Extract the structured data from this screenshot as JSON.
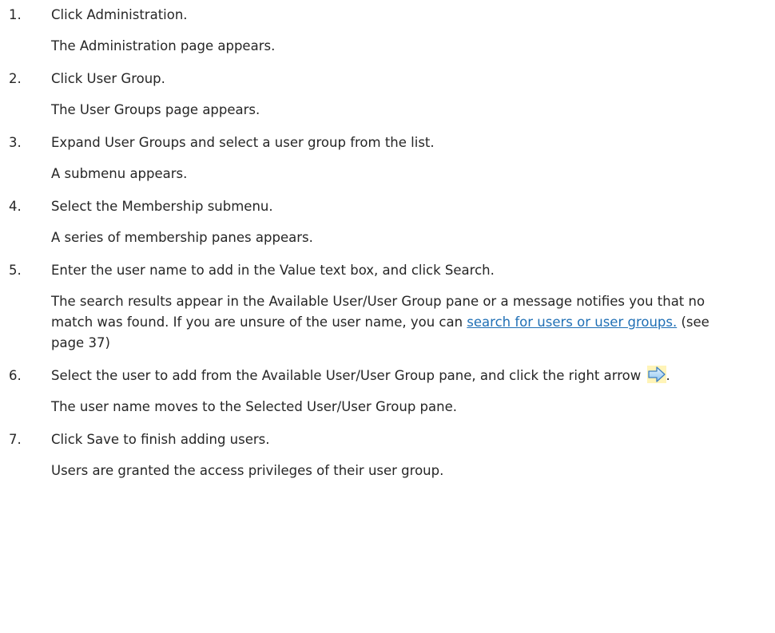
{
  "steps": [
    {
      "num": "1.",
      "text": "Click Administration.",
      "result": "The Administration page appears."
    },
    {
      "num": "2.",
      "text": "Click User Group.",
      "result": "The User Groups page appears."
    },
    {
      "num": "3.",
      "text": "Expand User Groups and select a user group from the list.",
      "result": "A submenu appears."
    },
    {
      "num": "4.",
      "text": "Select the Membership submenu.",
      "result": "A series of membership panes appears."
    },
    {
      "num": "5.",
      "text": "Enter the user name to add in the Value text box, and click Search.",
      "result_part1": "The search results appear in the Available User/User Group pane or a message notifies you that no match was found. If you are unsure of the user name, you can ",
      "result_link": "search for users or user groups.",
      "result_part2": " (see page 37)"
    },
    {
      "num": "6.",
      "text_part1": "Select the user to add from the Available User/User Group pane, and click the right arrow ",
      "text_part2": ".",
      "icon": "right-arrow-icon",
      "result": "The user name moves to the Selected User/User Group pane."
    },
    {
      "num": "7.",
      "text": "Click Save to finish adding users.",
      "result": "Users are granted the access privileges of their user group."
    }
  ]
}
